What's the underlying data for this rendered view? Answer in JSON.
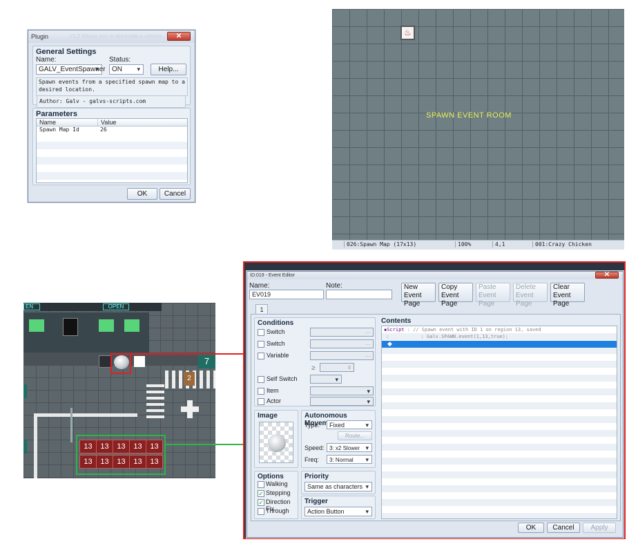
{
  "plugin": {
    "title": "Plugin",
    "title_blur": "v1.2 Allows you to drive/ride a vehicle...",
    "general_settings": "General Settings",
    "name_label": "Name:",
    "status_label": "Status:",
    "name_value": "GALV_EventSpawner",
    "status_value": "ON",
    "help_button": "Help...",
    "description": "Spawn events from a specified spawn map to a desired location.",
    "author": "Author: Galv - galvs-scripts.com",
    "parameters": "Parameters",
    "columns": [
      "Name",
      "Value"
    ],
    "rows": [
      {
        "name": "Spawn Map Id",
        "value": "26"
      }
    ],
    "ok": "OK",
    "cancel": "Cancel"
  },
  "spawnmap": {
    "room_label": "SPAWN EVENT ROOM",
    "status": [
      "026:Spawn Map (17x13)",
      "100%",
      "4,1",
      "001:Crazy Chicken"
    ]
  },
  "gamemap": {
    "sign_open": "OPEN",
    "sign_open2": "OPEN",
    "sign_en": "EN",
    "number7": "7",
    "number2": "2",
    "region": "13"
  },
  "event": {
    "title": "ID:019 - Event Editor",
    "name_label": "Name:",
    "name_value": "EV019",
    "note_label": "Note:",
    "buttons": [
      "New\nEvent Page",
      "Copy\nEvent Page",
      "Paste\nEvent Page",
      "Delete\nEvent Page",
      "Clear\nEvent Page"
    ],
    "tab": "1",
    "conditions": "Conditions",
    "cond_items": [
      "Switch",
      "Switch",
      "Variable",
      "Self Switch",
      "Item",
      "Actor"
    ],
    "ge": "≥",
    "image": "Image",
    "auto_move": "Autonomous Movement",
    "type_label": "Type:",
    "type_value": "Fixed",
    "route": "Route...",
    "speed_label": "Speed:",
    "speed_value": "3: x2 Slower",
    "freq_label": "Freq:",
    "freq_value": "3: Normal",
    "options": "Options",
    "opt_items": [
      "Walking",
      "Stepping",
      "Direction Fix",
      "Through"
    ],
    "priority": "Priority",
    "priority_value": "Same as characters",
    "trigger": "Trigger",
    "trigger_value": "Action Button",
    "contents": "Contents",
    "script_label": "◆Script",
    "script_line1": ": // Spawn event with ID 1 on region 13, saved",
    "script_line2": ":           : Galv.SPAWN.event(1,13,true);",
    "ok": "OK",
    "cancel": "Cancel",
    "apply": "Apply"
  },
  "colors": {
    "accent_red": "#e02020",
    "accent_green": "#2fb34a",
    "selection": "#1e7fe0"
  }
}
